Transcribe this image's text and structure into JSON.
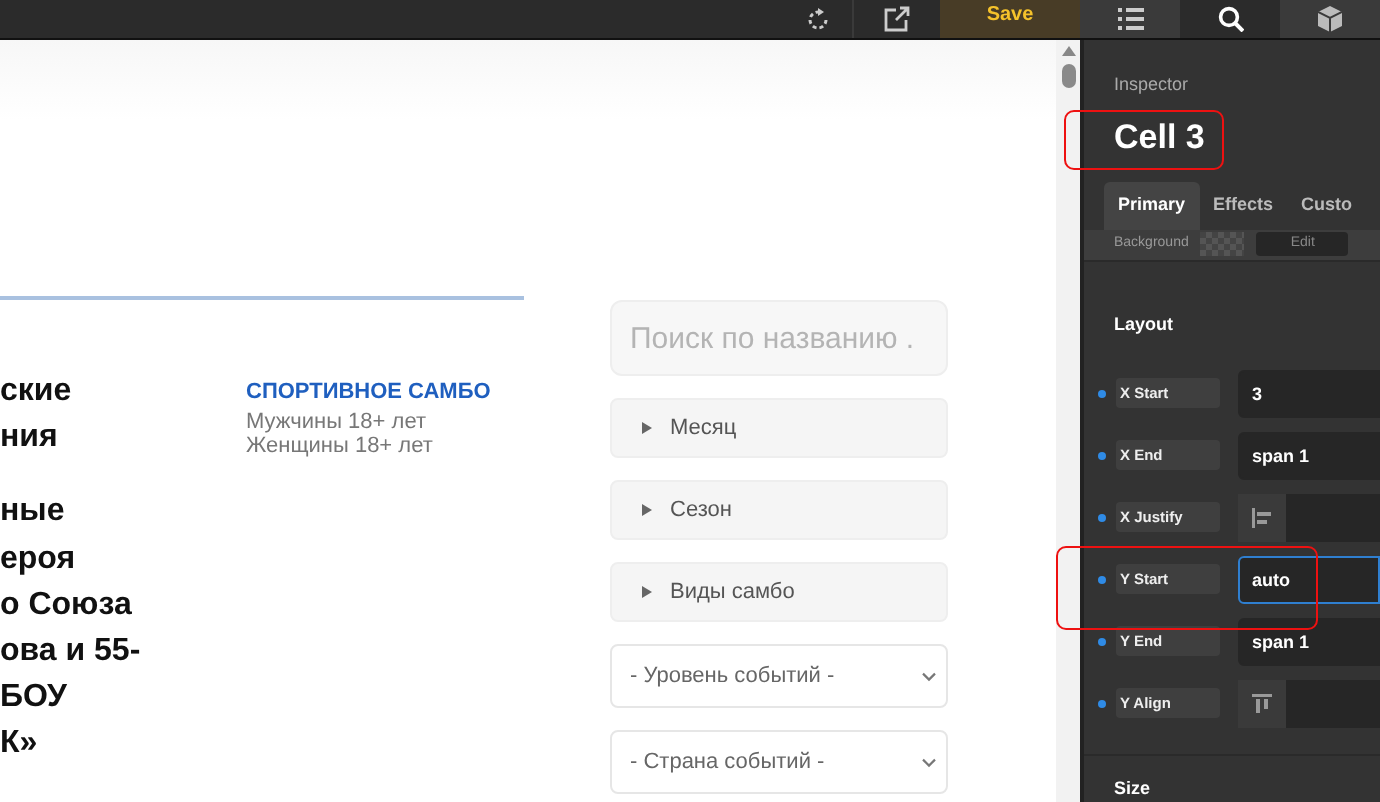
{
  "toolbar": {
    "save_button": "Save"
  },
  "content": {
    "title_fragments": [
      "ские",
      "ния",
      "ные",
      "ероя",
      "о Союза",
      "ова и 55-",
      "БОУ",
      "К»"
    ],
    "category": "СПОРТИВНОЕ САМБО",
    "details": [
      "Мужчины 18+ лет",
      "Женщины 18+ лет"
    ]
  },
  "filters": {
    "search": {
      "placeholder": "Поиск по названию ."
    },
    "collapsibles": [
      {
        "label": "Месяц",
        "expanded": false
      },
      {
        "label": "Сезон",
        "expanded": false
      },
      {
        "label": "Виды самбо",
        "expanded": false
      }
    ],
    "selects": [
      "- Уровень событий -",
      "- Страна событий -"
    ]
  },
  "inspector": {
    "icon_tabs": [
      {
        "kind": "list",
        "selected": false
      },
      {
        "kind": "search",
        "selected": true
      },
      {
        "kind": "cube",
        "selected": false
      }
    ],
    "title": "Inspector",
    "element_name": "Cell 3",
    "tabs": [
      {
        "label": "Primary",
        "selected": true
      },
      {
        "label": "Effects",
        "selected": false
      },
      {
        "label": "Custo",
        "selected": false
      }
    ],
    "background_row": {
      "label": "Background",
      "button": "Edit"
    },
    "section": "Layout",
    "properties": [
      {
        "label": "X Start",
        "kind": "text",
        "value": "3",
        "focused": false
      },
      {
        "label": "X End",
        "kind": "text",
        "value": "span 1",
        "focused": false
      },
      {
        "label": "X Justify",
        "kind": "align-left",
        "focused": false
      },
      {
        "label": "Y Start",
        "kind": "text",
        "value": "auto",
        "focused": true
      },
      {
        "label": "Y End",
        "kind": "text",
        "value": "span 1",
        "focused": false
      },
      {
        "label": "Y Align",
        "kind": "align-top",
        "focused": false
      }
    ],
    "next_section": "Size"
  }
}
